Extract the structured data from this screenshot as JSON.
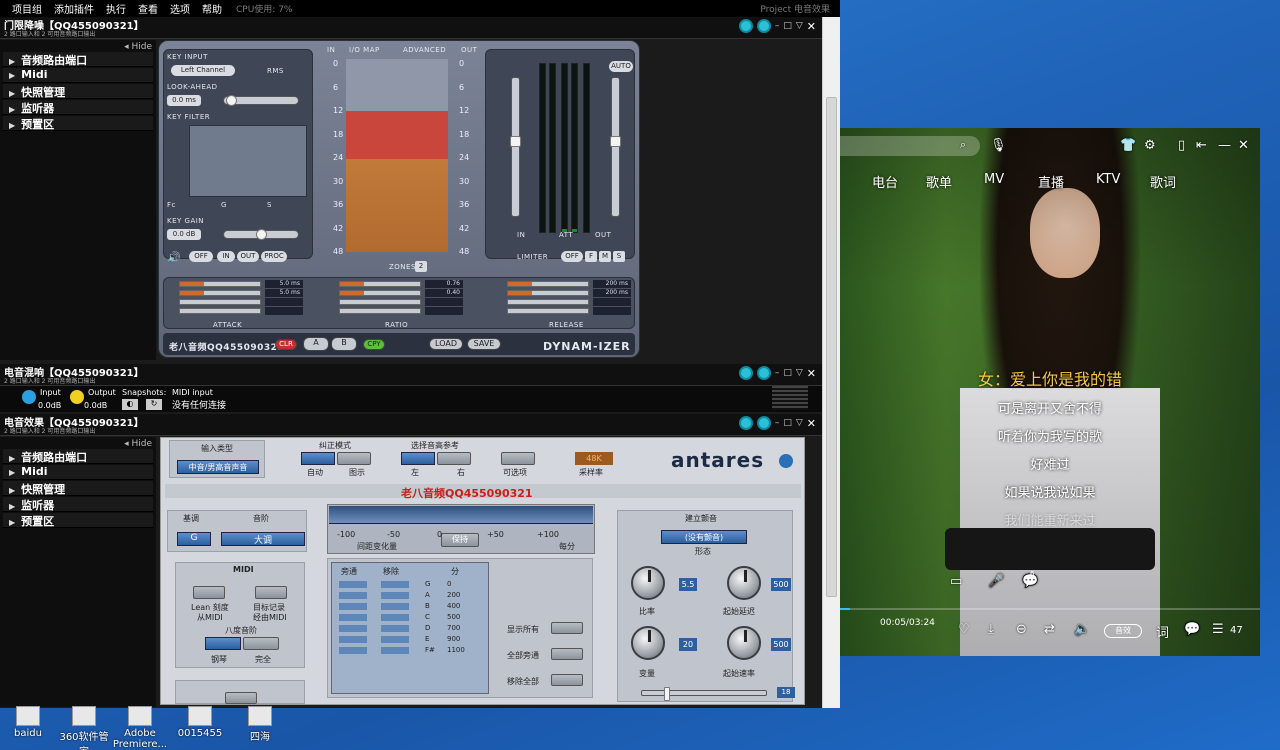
{
  "menubar": {
    "items": [
      "项目组",
      "添加插件",
      "执行",
      "查看",
      "选项",
      "帮助"
    ],
    "cpu": "CPU使用: 7%",
    "project": "Project 电音效果"
  },
  "win1": {
    "title": "门限降噪【QQ455090321】",
    "subtitle": "2 路口输入和 2 可用音频路口输出"
  },
  "win2": {
    "title": "电音混响【QQ455090321】",
    "subtitle": "2 路口输入和 2 可用音频路口输出"
  },
  "win3": {
    "title": "电音效果【QQ455090321】",
    "subtitle": "2 路口输入和 2 可用音频路口输出"
  },
  "sidebar": {
    "hide": "◂ Hide",
    "items": [
      "音频路由端口",
      "Midi",
      "快照管理",
      "监听器",
      "预置区"
    ]
  },
  "dyn": {
    "key_input": "KEY INPUT",
    "left_channel": "Left Channel",
    "rms": "RMS",
    "look_ahead": "LOOK-AHEAD",
    "look_val": "0.0 ms",
    "key_filter": "KEY FILTER",
    "fc": "Fc",
    "g": "G",
    "s": "S",
    "key_gain": "KEY GAIN",
    "gain_val": "0.0 dB",
    "btn_off": "OFF",
    "btn_in": "IN",
    "btn_out": "OUT",
    "btn_proc": "PROC",
    "io_map": "I/O MAP",
    "advanced": "ADVANCED",
    "in": "IN",
    "out": "OUT",
    "ticks": [
      "0",
      "6",
      "12",
      "18",
      "24",
      "30",
      "36",
      "42",
      "48"
    ],
    "zones": "ZONES",
    "zones_val": "2",
    "auto": "AUTO",
    "meter_in": "IN",
    "meter_att": "ATT",
    "meter_out": "OUT",
    "limiter": "LIMITER",
    "lim_off": "OFF",
    "lim_f": "F",
    "lim_m": "M",
    "lim_s": "S",
    "attack": "ATTACK",
    "ratio": "RATIO",
    "release": "RELEASE",
    "attack_vals": [
      "5.0 ms",
      "5.0 ms",
      "",
      ""
    ],
    "ratio_vals": [
      "0.76",
      "0.40",
      "",
      ""
    ],
    "release_vals": [
      "200 ms",
      "200 ms",
      "",
      ""
    ],
    "brand": "老八音频QQ455090321",
    "clr": "CLR",
    "a": "A",
    "b": "B",
    "cpy": "CPY",
    "load": "LOAD",
    "save": "SAVE",
    "logo": "DYNAM-IZER"
  },
  "mid": {
    "input": "Input",
    "input_val": "0.0dB",
    "output": "Output",
    "output_val": "0.0dB",
    "snapshots": "Snapshots:",
    "midi_input": "MIDI input",
    "midi_status": "没有任何连接"
  },
  "antares": {
    "input_type": "输入类型",
    "input_type_val": "中音/男高音声音",
    "corr_mode": "纠正模式",
    "auto": "自动",
    "graph": "图示",
    "pitch_ref": "选择音高参考",
    "left": "左",
    "right": "右",
    "options": "可选项",
    "rate": "48K",
    "rate_lbl": "采样率",
    "logo": "antares",
    "banner": "老八音频QQ455090321",
    "key": "基调",
    "scale": "音阶",
    "key_val": "G",
    "scale_val": "大调",
    "scale_ticks": [
      "-100",
      "-50",
      "0",
      "+50",
      "+100"
    ],
    "detune": "间距变化量",
    "keep": "保持",
    "cents": "每分",
    "midi": "MIDI",
    "learn": "Lean 刻度",
    "from_midi": "从MIDI",
    "target": "目标记录",
    "via_midi": "经由MIDI",
    "octave": "八度音阶",
    "piano": "钢琴",
    "full": "完全",
    "bypass": "旁通",
    "remove": "移除",
    "cents_col": "分",
    "notes": [
      "G",
      "A",
      "B",
      "C",
      "D",
      "E",
      "F#"
    ],
    "note_vals": [
      "0",
      "200",
      "400",
      "500",
      "700",
      "900",
      "1100"
    ],
    "show_all": "显示所有",
    "all_bypass": "全部旁通",
    "remove_all": "移除全部",
    "vibrato": "建立颤音",
    "vib_shape": "(没有颤音)",
    "shape": "形态",
    "rate_k": "比率",
    "rate_v": "5.5",
    "onset_delay": "起始延迟",
    "onset_delay_v": "500",
    "variation": "变量",
    "variation_v": "20",
    "onset_rate": "起始速率",
    "onset_rate_v": "500",
    "slider_v": "18"
  },
  "desktop": {
    "icons": [
      "baidu",
      "360软件管家",
      "Adobe Premiere...",
      "0015455",
      "四海"
    ]
  },
  "player": {
    "tabs": [
      "电台",
      "歌单",
      "MV",
      "直播",
      "KTV",
      "歌词"
    ],
    "lyrics": [
      "女：爱上你是我的错",
      "可是离开又舍不得",
      "听着你为我写的歌",
      "好难过",
      "如果说我说如果",
      "我们能重新来过"
    ],
    "time": "00:05/03:24",
    "quality": "音效",
    "lyric_btn": "词",
    "count": "47",
    "comment_count": "6"
  }
}
